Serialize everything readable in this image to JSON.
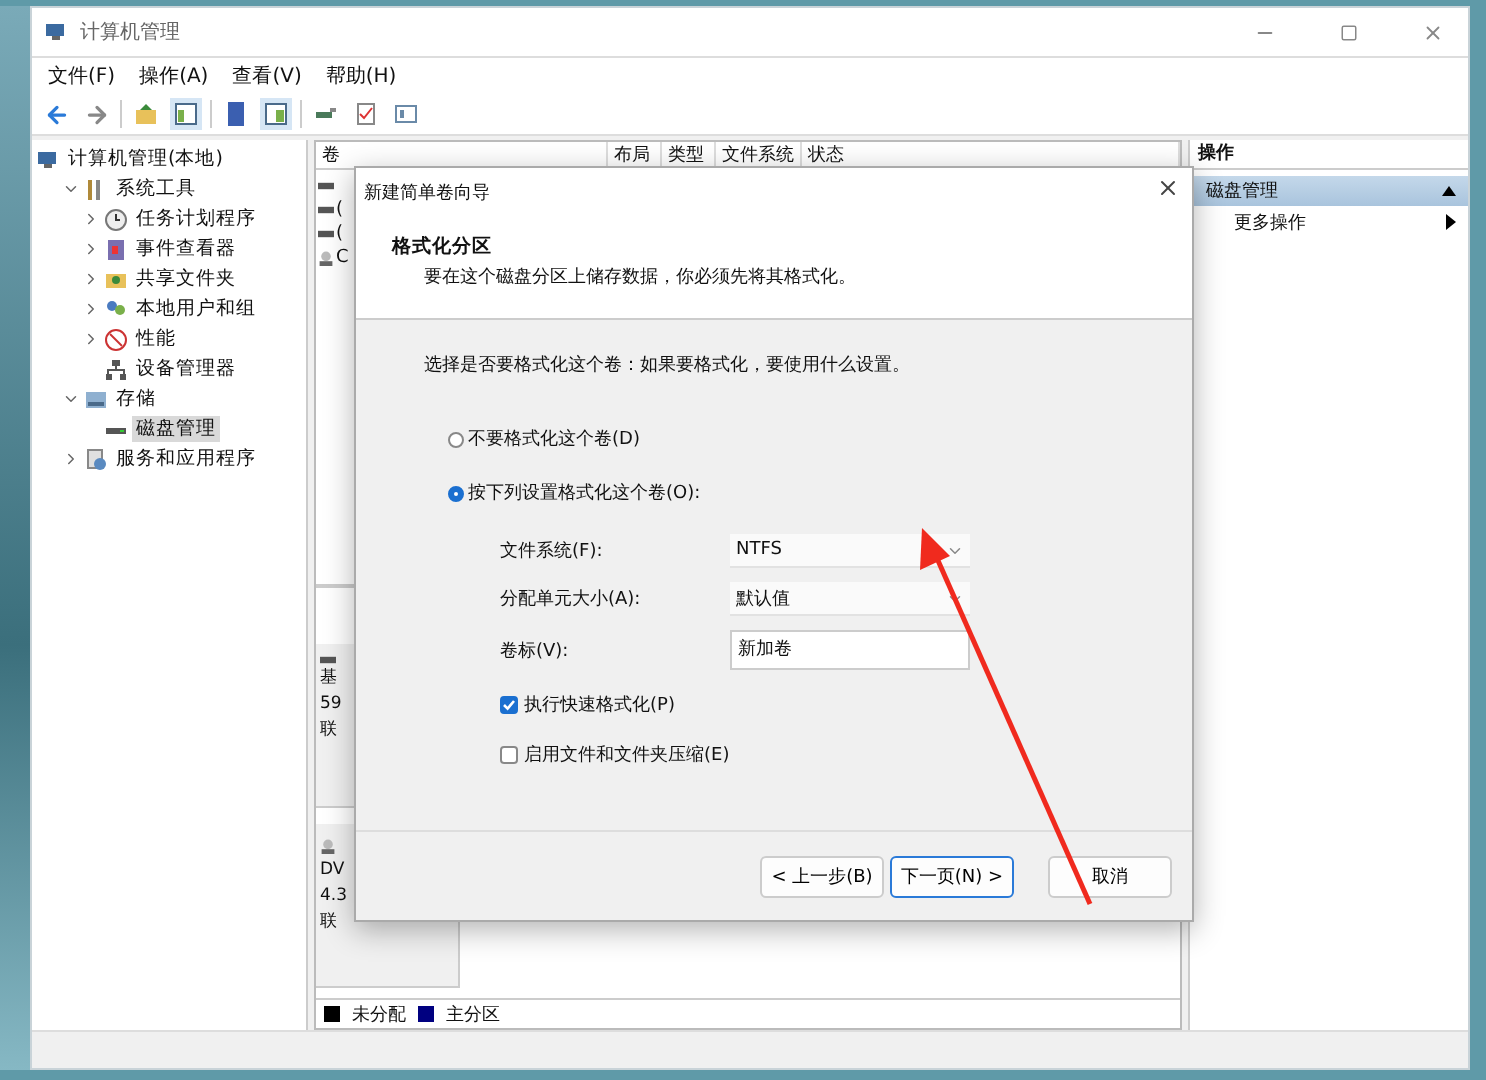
{
  "window": {
    "title": "计算机管理"
  },
  "menu": [
    "文件(F)",
    "操作(A)",
    "查看(V)",
    "帮助(H)"
  ],
  "tree": [
    {
      "label": "计算机管理(本地)",
      "kind": "computer",
      "selected": false,
      "children": [
        {
          "label": "系统工具",
          "kind": "tools",
          "expanded": true,
          "selected": false,
          "children": [
            {
              "label": "任务计划程序",
              "kind": "clock",
              "expanded": false,
              "selected": false
            },
            {
              "label": "事件查看器",
              "kind": "event",
              "expanded": false,
              "selected": false
            },
            {
              "label": "共享文件夹",
              "kind": "share",
              "expanded": false,
              "selected": false
            },
            {
              "label": "本地用户和组",
              "kind": "users",
              "expanded": false,
              "selected": false
            },
            {
              "label": "性能",
              "kind": "performance",
              "expanded": false,
              "selected": false
            },
            {
              "label": "设备管理器",
              "kind": "device",
              "selected": false
            }
          ]
        },
        {
          "label": "存储",
          "kind": "storage",
          "expanded": true,
          "selected": false,
          "children": [
            {
              "label": "磁盘管理",
              "kind": "disk",
              "selected": true
            }
          ]
        },
        {
          "label": "服务和应用程序",
          "kind": "services",
          "expanded": false,
          "selected": false
        }
      ]
    }
  ],
  "columns": [
    "卷",
    "布局",
    "类型",
    "文件系统",
    "状态"
  ],
  "volumes": [
    {
      "kind": "disk"
    },
    {
      "kind": "disk",
      "text": "("
    },
    {
      "kind": "disk",
      "text": "("
    },
    {
      "kind": "cdrom",
      "text": "C"
    }
  ],
  "disks": [
    {
      "kind": "disk",
      "lines": [
        "基",
        "59",
        "联"
      ]
    },
    {
      "kind": "cdrom",
      "lines": [
        "DV",
        "4.3",
        "联"
      ]
    }
  ],
  "legend": [
    {
      "label": "未分配",
      "color": "#000000"
    },
    {
      "label": "主分区",
      "color": "#000080"
    }
  ],
  "actions": {
    "header": "操作",
    "section": "磁盘管理",
    "items": [
      "更多操作"
    ]
  },
  "dialog": {
    "title": "新建简单卷向导",
    "heading": "格式化分区",
    "subtitle": "要在这个磁盘分区上储存数据，你必须先将其格式化。",
    "prompt": "选择是否要格式化这个卷：如果要格式化，要使用什么设置。",
    "radios": [
      {
        "label": "不要格式化这个卷(D)",
        "selected": false
      },
      {
        "label": "按下列设置格式化这个卷(O):",
        "selected": true
      }
    ],
    "fields": [
      {
        "label": "文件系统(F):",
        "kind": "select",
        "value": "NTFS"
      },
      {
        "label": "分配单元大小(A):",
        "kind": "select",
        "value": "默认值"
      },
      {
        "label": "卷标(V):",
        "kind": "text",
        "value": "新加卷"
      }
    ],
    "checkboxes": [
      {
        "label": "执行快速格式化(P)",
        "checked": true
      },
      {
        "label": "启用文件和文件夹压缩(E)",
        "checked": false
      }
    ],
    "buttons": [
      {
        "label": "< 上一步(B)",
        "kind": "default"
      },
      {
        "label": "下一页(N) >",
        "kind": "primary"
      },
      {
        "label": "取消",
        "kind": "cancel"
      }
    ]
  }
}
